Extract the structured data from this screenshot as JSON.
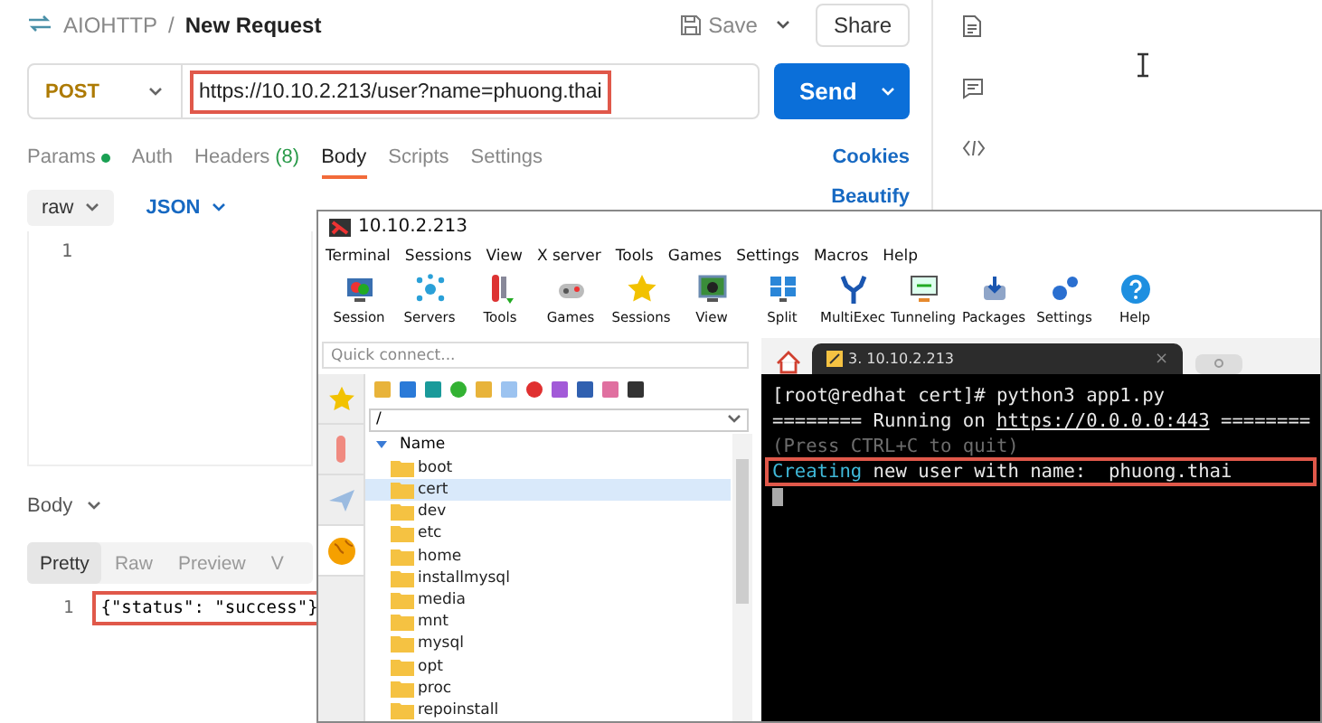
{
  "request_app": {
    "breadcrumb": {
      "collection": "AIOHTTP",
      "separator": "/",
      "request": "New Request"
    },
    "save_label": "Save",
    "share_label": "Share",
    "method": "POST",
    "url": "https://10.10.2.213/user?name=phuong.thai",
    "url_highlighted": true,
    "send_label": "Send",
    "tabs": [
      {
        "label": "Params",
        "indicator": true,
        "selected": false
      },
      {
        "label": "Auth",
        "indicator": false,
        "selected": false
      },
      {
        "label": "Headers",
        "count": "(8)",
        "indicator": false,
        "selected": false
      },
      {
        "label": "Body",
        "indicator": false,
        "selected": true
      },
      {
        "label": "Scripts",
        "indicator": false,
        "selected": false
      },
      {
        "label": "Settings",
        "indicator": false,
        "selected": false
      }
    ],
    "cookies_label": "Cookies",
    "body_mode": "raw",
    "body_format": "JSON",
    "beautify_label": "Beautify",
    "editor_lines": [
      "1"
    ],
    "response_label": "Body",
    "response_tabs": [
      {
        "label": "Pretty",
        "selected": true
      },
      {
        "label": "Raw",
        "selected": false
      },
      {
        "label": "Preview",
        "selected": false
      },
      {
        "label": "V",
        "selected": false
      }
    ],
    "response_lines": [
      {
        "number": "1",
        "text": "{\"status\": \"success\"}",
        "highlighted": true
      }
    ]
  },
  "terminal_app": {
    "title": "10.10.2.213",
    "menu": [
      "Terminal",
      "Sessions",
      "View",
      "X server",
      "Tools",
      "Games",
      "Settings",
      "Macros",
      "Help"
    ],
    "toolbar": [
      "Session",
      "Servers",
      "Tools",
      "Games",
      "Sessions",
      "View",
      "Split",
      "MultiExec",
      "Tunneling",
      "Packages",
      "Settings",
      "Help"
    ],
    "side_tabs": [
      {
        "selected": false
      },
      {
        "selected": false
      },
      {
        "selected": false
      },
      {
        "selected": true
      }
    ],
    "quick_connect_placeholder": "Quick connect...",
    "path": "/",
    "tree_header": "Name",
    "folders": [
      {
        "name": "boot",
        "selected": false
      },
      {
        "name": "cert",
        "selected": true
      },
      {
        "name": "dev",
        "selected": false
      },
      {
        "name": "etc",
        "selected": false
      },
      {
        "name": "home",
        "selected": false
      },
      {
        "name": "installmysql",
        "selected": false
      },
      {
        "name": "media",
        "selected": false
      },
      {
        "name": "mnt",
        "selected": false
      },
      {
        "name": "mysql",
        "selected": false
      },
      {
        "name": "opt",
        "selected": false
      },
      {
        "name": "proc",
        "selected": false
      },
      {
        "name": "repoinstall",
        "selected": false
      }
    ],
    "tab_label": "3. 10.10.2.213",
    "tab_close": "×",
    "lines": [
      {
        "highlighted": false,
        "segments": [
          {
            "kind": "plain",
            "text": "[root@redhat cert]# python3 app1.py"
          }
        ]
      },
      {
        "highlighted": false,
        "segments": [
          {
            "kind": "plain",
            "text": "======== Running on "
          },
          {
            "kind": "link",
            "text": "https://0.0.0.0:443"
          },
          {
            "kind": "plain",
            "text": " ========"
          }
        ]
      },
      {
        "highlighted": false,
        "segments": [
          {
            "kind": "faded",
            "text": "(Press CTRL+C to quit)"
          }
        ]
      },
      {
        "highlighted": true,
        "segments": [
          {
            "kind": "accent",
            "text": "Creating"
          },
          {
            "kind": "plain",
            "text": " new user with name:  phuong.thai"
          }
        ]
      }
    ]
  }
}
